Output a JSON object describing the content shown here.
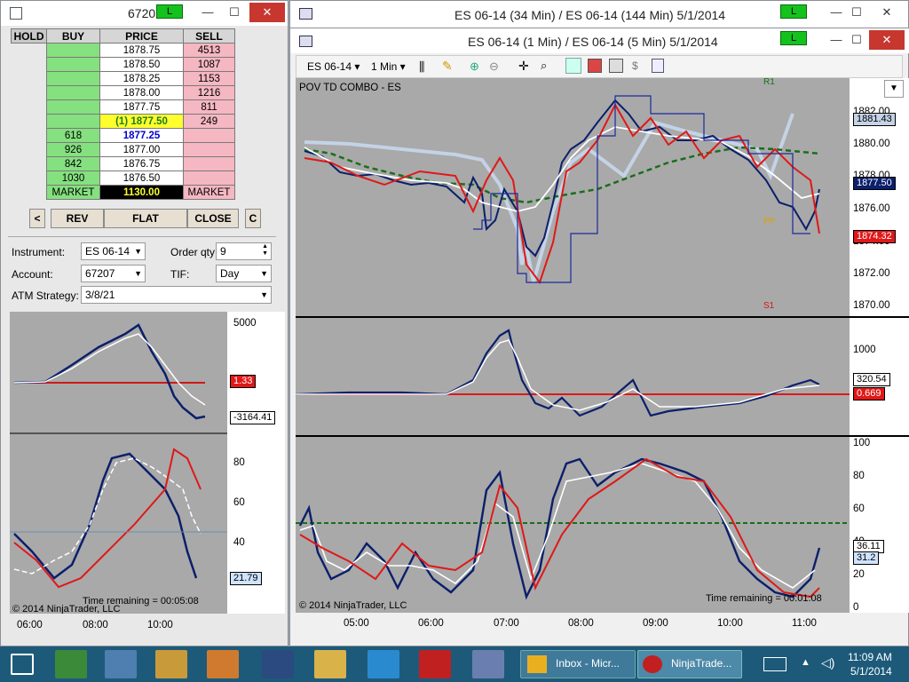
{
  "dom_window": {
    "title": "6720",
    "link_label": "L",
    "headers": [
      "HOLD",
      "BUY",
      "PRICE",
      "SELL"
    ],
    "rows": [
      {
        "buy": "",
        "price": "1878.75",
        "sell": "4513"
      },
      {
        "buy": "",
        "price": "1878.50",
        "sell": "1087"
      },
      {
        "buy": "",
        "price": "1878.25",
        "sell": "1153"
      },
      {
        "buy": "",
        "price": "1878.00",
        "sell": "1216"
      },
      {
        "buy": "",
        "price": "1877.75",
        "sell": "811"
      },
      {
        "buy": "",
        "price": "(1) 1877.50",
        "sell": "249"
      },
      {
        "buy": "618",
        "price": "1877.25",
        "sell": ""
      },
      {
        "buy": "926",
        "price": "1877.00",
        "sell": ""
      },
      {
        "buy": "842",
        "price": "1876.75",
        "sell": ""
      },
      {
        "buy": "1030",
        "price": "1876.50",
        "sell": ""
      }
    ],
    "market_row": {
      "buy": "MARKET",
      "price": "1130.00",
      "sell": "MARKET"
    },
    "buttons": {
      "left": "<",
      "rev": "REV",
      "flat": "FLAT",
      "close": "CLOSE",
      "c": "C"
    },
    "fields": {
      "instrument_label": "Instrument:",
      "instrument_value": "ES 06-14",
      "orderqty_label": "Order qty:",
      "orderqty_value": "9",
      "account_label": "Account:",
      "account_value": "67207",
      "tif_label": "TIF:",
      "tif_value": "Day",
      "atm_label": "ATM Strategy:",
      "atm_value": "3/8/21"
    }
  },
  "left_chart": {
    "y_axis_top": [
      "5000"
    ],
    "tag_red": "1.33",
    "tag_white": "-3164.41",
    "y_axis_bottom": [
      "80",
      "60",
      "40"
    ],
    "tag_blue": "21.79",
    "time_remaining": "Time remaining = 00:05:08",
    "copyright": "© 2014 NinjaTrader, LLC",
    "x_axis": [
      "06:00",
      "08:00",
      "10:00"
    ]
  },
  "back_window": {
    "title": "ES 06-14 (34 Min) / ES 06-14 (144 Min)  5/1/2014",
    "link_label": "L"
  },
  "main_window": {
    "title": "ES 06-14 (1 Min) / ES 06-14 (5 Min)  5/1/2014",
    "link_label": "L",
    "toolbar": {
      "instrument": "ES 06-14",
      "interval": "1 Min"
    },
    "chart_title": "POV TD COMBO - ES",
    "price_axis": [
      "1882.00",
      "1880.00",
      "1878.00",
      "1876.00",
      "1874.00",
      "1872.00",
      "1870.00"
    ],
    "tag_r1_price": "1881.43",
    "tag_last": "1877.50",
    "tag_red_price": "1874.32",
    "label_r1": "R1",
    "label_pp": "PP",
    "label_s1": "S1",
    "mid_axis": [
      "1000"
    ],
    "tag_mid_white": "320.54",
    "tag_mid_red": "0.669",
    "low_axis": [
      "100",
      "80",
      "60",
      "40",
      "20",
      "0"
    ],
    "tag_low_1": "36.11",
    "tag_low_2": "31.2",
    "time_remaining": "Time remaining = 00:01:08",
    "copyright": "© 2014 NinjaTrader, LLC",
    "x_axis": [
      "05:00",
      "06:00",
      "07:00",
      "08:00",
      "09:00",
      "10:00",
      "11:00"
    ]
  },
  "taskbar": {
    "inbox": "Inbox - Micr...",
    "ninja": "NinjaTrade...",
    "time": "11:09 AM",
    "date": "5/1/2014"
  }
}
